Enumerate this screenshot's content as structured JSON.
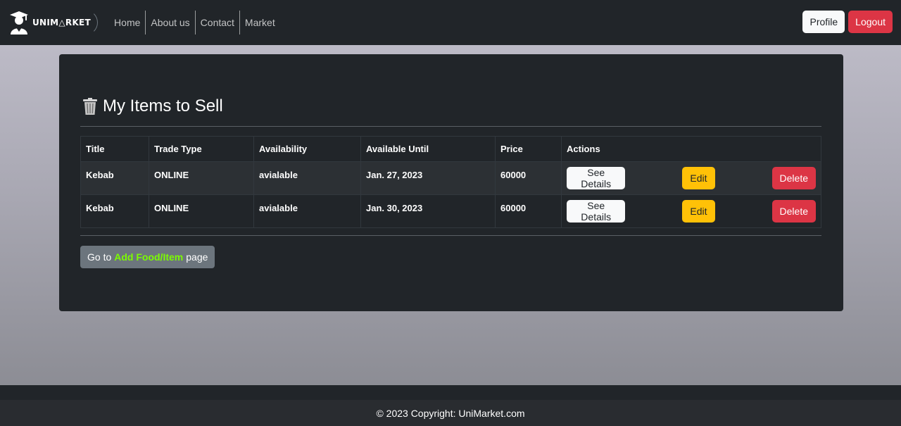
{
  "brand": {
    "name": "UNIM△RKET"
  },
  "nav": {
    "links": [
      "Home",
      "About us",
      "Contact",
      "Market"
    ]
  },
  "header_actions": {
    "profile": "Profile",
    "logout": "Logout"
  },
  "page": {
    "title": "My Items to Sell",
    "title_icon": "trash-can-icon"
  },
  "table": {
    "headers": [
      "Title",
      "Trade Type",
      "Availability",
      "Available Until",
      "Price",
      "Actions"
    ],
    "rows": [
      {
        "title": "Kebab",
        "trade_type": "ONLINE",
        "availability": "avialable",
        "available_until": "Jan. 27, 2023",
        "price": "60000"
      },
      {
        "title": "Kebab",
        "trade_type": "ONLINE",
        "availability": "avialable",
        "available_until": "Jan. 30, 2023",
        "price": "60000"
      }
    ],
    "action_labels": {
      "details": "See Details",
      "edit": "Edit",
      "delete": "Delete"
    }
  },
  "add_link": {
    "prefix": "Go to",
    "highlight": "Add Food/Item",
    "suffix": "page"
  },
  "footer": {
    "text": "© 2023 Copyright: UniMarket.com"
  },
  "colors": {
    "navbar": "#212529",
    "danger": "#dc3545",
    "warning": "#ffc107",
    "secondary": "#6c757d",
    "highlight": "#7cfc00"
  }
}
